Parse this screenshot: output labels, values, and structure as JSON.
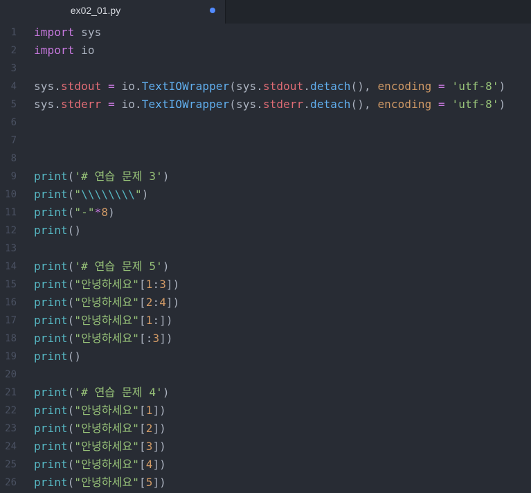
{
  "tab": {
    "title": "ex02_01.py",
    "modified": true
  },
  "colors": {
    "background": "#282c34",
    "keyword": "#c678dd",
    "string": "#98c379",
    "number": "#d19a66",
    "function": "#61afef",
    "builtin": "#56b6c2",
    "attribute": "#e06c75",
    "modified_dot": "#528bff"
  },
  "lines": [
    {
      "n": "1",
      "tokens": [
        {
          "t": "import",
          "c": "keyword"
        },
        {
          "t": " sys",
          "c": "plain"
        }
      ]
    },
    {
      "n": "2",
      "tokens": [
        {
          "t": "import",
          "c": "keyword"
        },
        {
          "t": " io",
          "c": "plain"
        }
      ]
    },
    {
      "n": "3",
      "tokens": []
    },
    {
      "n": "4",
      "tokens": [
        {
          "t": "sys.",
          "c": "plain"
        },
        {
          "t": "stdout",
          "c": "attr"
        },
        {
          "t": " ",
          "c": "plain"
        },
        {
          "t": "=",
          "c": "op"
        },
        {
          "t": " io.",
          "c": "plain"
        },
        {
          "t": "TextIOWrapper",
          "c": "func"
        },
        {
          "t": "(sys.",
          "c": "plain"
        },
        {
          "t": "stdout",
          "c": "attr"
        },
        {
          "t": ".",
          "c": "plain"
        },
        {
          "t": "detach",
          "c": "func"
        },
        {
          "t": "(), ",
          "c": "plain"
        },
        {
          "t": "encoding",
          "c": "param"
        },
        {
          "t": " ",
          "c": "plain"
        },
        {
          "t": "=",
          "c": "op"
        },
        {
          "t": " ",
          "c": "plain"
        },
        {
          "t": "'utf-8'",
          "c": "string"
        },
        {
          "t": ")",
          "c": "plain"
        }
      ]
    },
    {
      "n": "5",
      "tokens": [
        {
          "t": "sys.",
          "c": "plain"
        },
        {
          "t": "stderr",
          "c": "attr"
        },
        {
          "t": " ",
          "c": "plain"
        },
        {
          "t": "=",
          "c": "op"
        },
        {
          "t": " io.",
          "c": "plain"
        },
        {
          "t": "TextIOWrapper",
          "c": "func"
        },
        {
          "t": "(sys.",
          "c": "plain"
        },
        {
          "t": "stderr",
          "c": "attr"
        },
        {
          "t": ".",
          "c": "plain"
        },
        {
          "t": "detach",
          "c": "func"
        },
        {
          "t": "(), ",
          "c": "plain"
        },
        {
          "t": "encoding",
          "c": "param"
        },
        {
          "t": " ",
          "c": "plain"
        },
        {
          "t": "=",
          "c": "op"
        },
        {
          "t": " ",
          "c": "plain"
        },
        {
          "t": "'utf-8'",
          "c": "string"
        },
        {
          "t": ")",
          "c": "plain"
        }
      ]
    },
    {
      "n": "6",
      "tokens": []
    },
    {
      "n": "7",
      "tokens": []
    },
    {
      "n": "8",
      "tokens": []
    },
    {
      "n": "9",
      "tokens": [
        {
          "t": "print",
          "c": "builtin"
        },
        {
          "t": "(",
          "c": "plain"
        },
        {
          "t": "'# 연습 문제 3'",
          "c": "string"
        },
        {
          "t": ")",
          "c": "plain"
        }
      ]
    },
    {
      "n": "10",
      "tokens": [
        {
          "t": "print",
          "c": "builtin"
        },
        {
          "t": "(",
          "c": "plain"
        },
        {
          "t": "\"",
          "c": "string"
        },
        {
          "t": "\\\\\\\\\\\\\\\\",
          "c": "escape"
        },
        {
          "t": "\"",
          "c": "string"
        },
        {
          "t": ")",
          "c": "plain"
        }
      ]
    },
    {
      "n": "11",
      "tokens": [
        {
          "t": "print",
          "c": "builtin"
        },
        {
          "t": "(",
          "c": "plain"
        },
        {
          "t": "\"-\"",
          "c": "string"
        },
        {
          "t": "*",
          "c": "op"
        },
        {
          "t": "8",
          "c": "number"
        },
        {
          "t": ")",
          "c": "plain"
        }
      ]
    },
    {
      "n": "12",
      "tokens": [
        {
          "t": "print",
          "c": "builtin"
        },
        {
          "t": "()",
          "c": "plain"
        }
      ]
    },
    {
      "n": "13",
      "tokens": []
    },
    {
      "n": "14",
      "tokens": [
        {
          "t": "print",
          "c": "builtin"
        },
        {
          "t": "(",
          "c": "plain"
        },
        {
          "t": "'# 연습 문제 5'",
          "c": "string"
        },
        {
          "t": ")",
          "c": "plain"
        }
      ]
    },
    {
      "n": "15",
      "tokens": [
        {
          "t": "print",
          "c": "builtin"
        },
        {
          "t": "(",
          "c": "plain"
        },
        {
          "t": "\"안녕하세요\"",
          "c": "string"
        },
        {
          "t": "[",
          "c": "plain"
        },
        {
          "t": "1",
          "c": "number"
        },
        {
          "t": ":",
          "c": "plain"
        },
        {
          "t": "3",
          "c": "number"
        },
        {
          "t": "])",
          "c": "plain"
        }
      ]
    },
    {
      "n": "16",
      "tokens": [
        {
          "t": "print",
          "c": "builtin"
        },
        {
          "t": "(",
          "c": "plain"
        },
        {
          "t": "\"안녕하세요\"",
          "c": "string"
        },
        {
          "t": "[",
          "c": "plain"
        },
        {
          "t": "2",
          "c": "number"
        },
        {
          "t": ":",
          "c": "plain"
        },
        {
          "t": "4",
          "c": "number"
        },
        {
          "t": "])",
          "c": "plain"
        }
      ]
    },
    {
      "n": "17",
      "tokens": [
        {
          "t": "print",
          "c": "builtin"
        },
        {
          "t": "(",
          "c": "plain"
        },
        {
          "t": "\"안녕하세요\"",
          "c": "string"
        },
        {
          "t": "[",
          "c": "plain"
        },
        {
          "t": "1",
          "c": "number"
        },
        {
          "t": ":])",
          "c": "plain"
        }
      ]
    },
    {
      "n": "18",
      "tokens": [
        {
          "t": "print",
          "c": "builtin"
        },
        {
          "t": "(",
          "c": "plain"
        },
        {
          "t": "\"안녕하세요\"",
          "c": "string"
        },
        {
          "t": "[:",
          "c": "plain"
        },
        {
          "t": "3",
          "c": "number"
        },
        {
          "t": "])",
          "c": "plain"
        }
      ]
    },
    {
      "n": "19",
      "tokens": [
        {
          "t": "print",
          "c": "builtin"
        },
        {
          "t": "()",
          "c": "plain"
        }
      ]
    },
    {
      "n": "20",
      "tokens": []
    },
    {
      "n": "21",
      "tokens": [
        {
          "t": "print",
          "c": "builtin"
        },
        {
          "t": "(",
          "c": "plain"
        },
        {
          "t": "'# 연습 문제 4'",
          "c": "string"
        },
        {
          "t": ")",
          "c": "plain"
        }
      ]
    },
    {
      "n": "22",
      "tokens": [
        {
          "t": "print",
          "c": "builtin"
        },
        {
          "t": "(",
          "c": "plain"
        },
        {
          "t": "\"안녕하세요\"",
          "c": "string"
        },
        {
          "t": "[",
          "c": "plain"
        },
        {
          "t": "1",
          "c": "number"
        },
        {
          "t": "])",
          "c": "plain"
        }
      ]
    },
    {
      "n": "23",
      "tokens": [
        {
          "t": "print",
          "c": "builtin"
        },
        {
          "t": "(",
          "c": "plain"
        },
        {
          "t": "\"안녕하세요\"",
          "c": "string"
        },
        {
          "t": "[",
          "c": "plain"
        },
        {
          "t": "2",
          "c": "number"
        },
        {
          "t": "])",
          "c": "plain"
        }
      ]
    },
    {
      "n": "24",
      "tokens": [
        {
          "t": "print",
          "c": "builtin"
        },
        {
          "t": "(",
          "c": "plain"
        },
        {
          "t": "\"안녕하세요\"",
          "c": "string"
        },
        {
          "t": "[",
          "c": "plain"
        },
        {
          "t": "3",
          "c": "number"
        },
        {
          "t": "])",
          "c": "plain"
        }
      ]
    },
    {
      "n": "25",
      "tokens": [
        {
          "t": "print",
          "c": "builtin"
        },
        {
          "t": "(",
          "c": "plain"
        },
        {
          "t": "\"안녕하세요\"",
          "c": "string"
        },
        {
          "t": "[",
          "c": "plain"
        },
        {
          "t": "4",
          "c": "number"
        },
        {
          "t": "])",
          "c": "plain"
        }
      ]
    },
    {
      "n": "26",
      "tokens": [
        {
          "t": "print",
          "c": "builtin"
        },
        {
          "t": "(",
          "c": "plain"
        },
        {
          "t": "\"안녕하세요\"",
          "c": "string"
        },
        {
          "t": "[",
          "c": "plain"
        },
        {
          "t": "5",
          "c": "number"
        },
        {
          "t": "])",
          "c": "plain"
        }
      ]
    }
  ]
}
